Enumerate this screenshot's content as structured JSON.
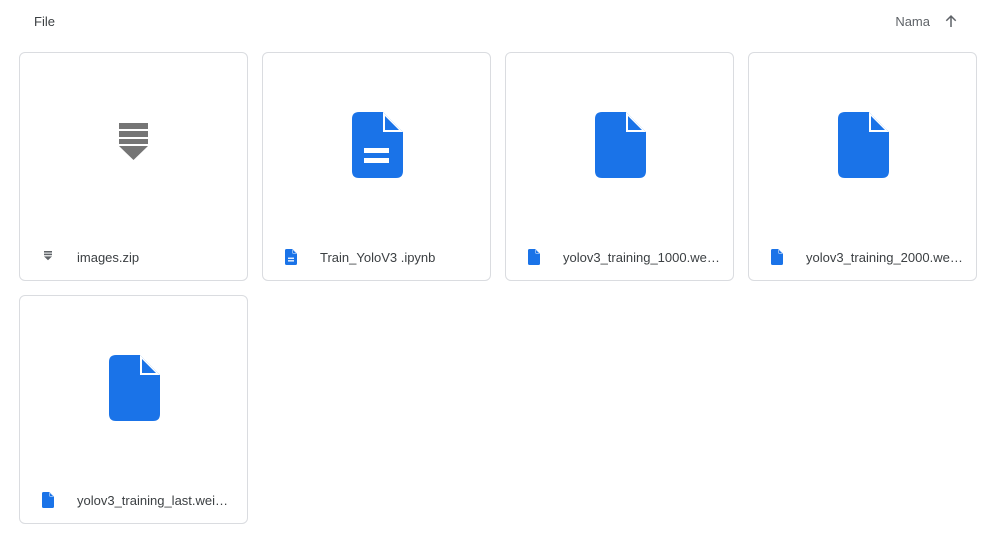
{
  "header": {
    "section_title": "File",
    "sort_label": "Nama",
    "sort_direction_icon": "arrow-up-icon"
  },
  "colors": {
    "doc_blue": "#1a73e8",
    "zip_gray": "#757575",
    "card_border": "#dadce0",
    "text": "#3c4043"
  },
  "files": [
    {
      "name": "images.zip",
      "icon": "zip-icon"
    },
    {
      "name": "Train_YoloV3 .ipynb",
      "icon": "google-doc-icon"
    },
    {
      "name": "yolov3_training_1000.wei…",
      "icon": "file-icon"
    },
    {
      "name": "yolov3_training_2000.wei…",
      "icon": "file-icon"
    },
    {
      "name": "yolov3_training_last.weig…",
      "icon": "file-icon"
    }
  ]
}
